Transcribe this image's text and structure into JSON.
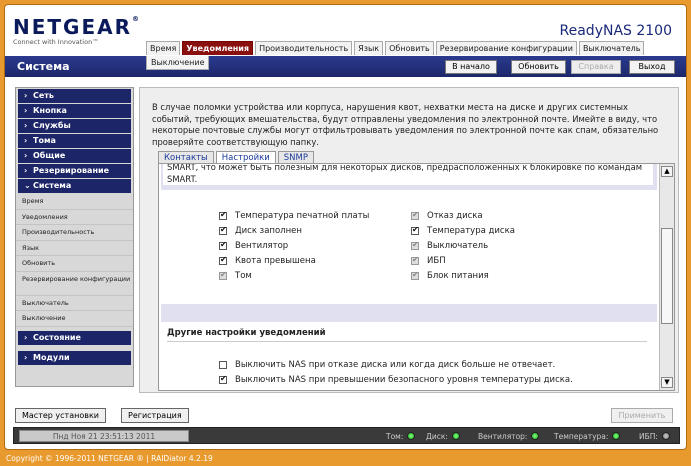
{
  "brand": {
    "name": "NETGEAR",
    "reg": "®",
    "tagline": "Connect with Innovation™"
  },
  "product": "ReadyNAS 2100",
  "main_tabs": [
    {
      "label": "Время",
      "active": false
    },
    {
      "label": "Уведомления",
      "active": true
    },
    {
      "label": "Производительность",
      "active": false
    },
    {
      "label": "Язык",
      "active": false
    },
    {
      "label": "Обновить",
      "active": false
    },
    {
      "label": "Резервирование конфигурации",
      "active": false
    },
    {
      "label": "Выключатель",
      "active": false
    }
  ],
  "sub_tab": "Выключение",
  "navbar": {
    "title": "Система",
    "home": "В начало",
    "refresh": "Обновить",
    "help": "Справка",
    "logout": "Выход"
  },
  "sidebar": {
    "sections": [
      {
        "label": "Сеть",
        "chevron": "›"
      },
      {
        "label": "Кнопка",
        "chevron": "›"
      },
      {
        "label": "Службы",
        "chevron": "›"
      },
      {
        "label": "Тома",
        "chevron": "›"
      },
      {
        "label": "Общие",
        "chevron": "›"
      },
      {
        "label": "Резервирование",
        "chevron": "›"
      },
      {
        "label": "Система",
        "chevron": "⌄"
      }
    ],
    "items": [
      "Время",
      "Уведомления",
      "Производительность",
      "Язык",
      "Обновить",
      "Резервирование конфигурации",
      "Выключатель",
      "Выключение"
    ],
    "bottom_sections": [
      {
        "label": "Состояние",
        "chevron": "›"
      },
      {
        "label": "Модули",
        "chevron": "›"
      }
    ]
  },
  "description": "В случае поломки устройства или корпуса, нарушения квот, нехватки места на диске и других системных событий, требующих вмешательства, будут отправлены уведомления по электронной почте. Имейте в виду, что некоторые почтовые службы могут отфильтровывать уведомления по электронной почте как спам, обязательно проверяйте соответствующую папку.",
  "content_tabs": [
    {
      "label": "Контакты",
      "active": false
    },
    {
      "label": "Настройки",
      "active": true
    },
    {
      "label": "SNMP",
      "active": false
    }
  ],
  "smart_note": "SMART, что может быть полезным для некоторых дисков, предрасположенных к блокировке по командам SMART.",
  "alerts_left": [
    {
      "label": "Температура печатной платы",
      "checked": true,
      "disabled": false
    },
    {
      "label": "Диск заполнен",
      "checked": true,
      "disabled": false
    },
    {
      "label": "Вентилятор",
      "checked": true,
      "disabled": false
    },
    {
      "label": "Квота превышена",
      "checked": true,
      "disabled": false
    },
    {
      "label": "Том",
      "checked": true,
      "disabled": true
    }
  ],
  "alerts_right": [
    {
      "label": "Отказ диска",
      "checked": true,
      "disabled": true
    },
    {
      "label": "Температура диска",
      "checked": true,
      "disabled": false
    },
    {
      "label": "Выключатель",
      "checked": true,
      "disabled": true
    },
    {
      "label": "ИБП",
      "checked": true,
      "disabled": true
    },
    {
      "label": "Блок питания",
      "checked": true,
      "disabled": true
    }
  ],
  "other_settings": {
    "title": "Другие настройки уведомлений",
    "options": [
      {
        "label": "Выключить NAS при отказе диска или когда диск больше не отвечает.",
        "checked": false
      },
      {
        "label": "Выключить NAS при превышении безопасного уровня температуры диска.",
        "checked": true
      }
    ]
  },
  "bottom": {
    "wizard": "Мастер установки",
    "register": "Регистрация",
    "apply": "Применить"
  },
  "status": {
    "datetime": "Пнд Ноя 21  23:51:13 2011",
    "indicators": [
      {
        "label": "Том:",
        "state": "ok"
      },
      {
        "label": "Диск:",
        "state": "ok"
      },
      {
        "label": "Вентилятор:",
        "state": "ok"
      },
      {
        "label": "Температура:",
        "state": "ok"
      },
      {
        "label": "ИБП:",
        "state": "off"
      }
    ]
  },
  "copyright": "Copyright © 1996-2011 NETGEAR ® | RAIDiator 4.2.19",
  "colors": {
    "accent": "#8a1010",
    "navbar": "#1c276a",
    "page_bg": "#e89a2e",
    "led_ok": "#22aa22"
  }
}
